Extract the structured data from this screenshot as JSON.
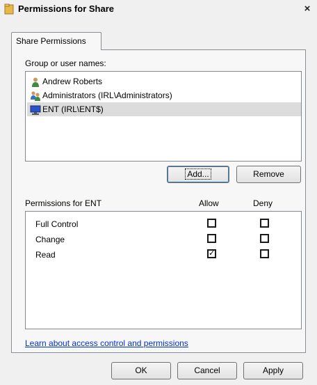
{
  "window": {
    "title": "Permissions for Share",
    "close_glyph": "×"
  },
  "tab": {
    "label": "Share Permissions"
  },
  "groups": {
    "label": "Group or user names:",
    "users": [
      {
        "name": "Andrew Roberts",
        "icon": "user-icon"
      },
      {
        "name": "Administrators (IRL\\Administrators)",
        "icon": "group-icon"
      },
      {
        "name": "ENT (IRL\\ENT$)",
        "icon": "computer-icon",
        "selected": true
      }
    ]
  },
  "buttons": {
    "add": "Add...",
    "remove": "Remove",
    "ok": "OK",
    "cancel": "Cancel",
    "apply": "Apply"
  },
  "permissions": {
    "label": "Permissions for ENT",
    "allow_header": "Allow",
    "deny_header": "Deny",
    "rows": [
      {
        "name": "Full Control",
        "allow": false,
        "deny": false
      },
      {
        "name": "Change",
        "allow": false,
        "deny": false
      },
      {
        "name": "Read",
        "allow": true,
        "deny": false
      }
    ]
  },
  "help_link": "Learn about access control and permissions"
}
